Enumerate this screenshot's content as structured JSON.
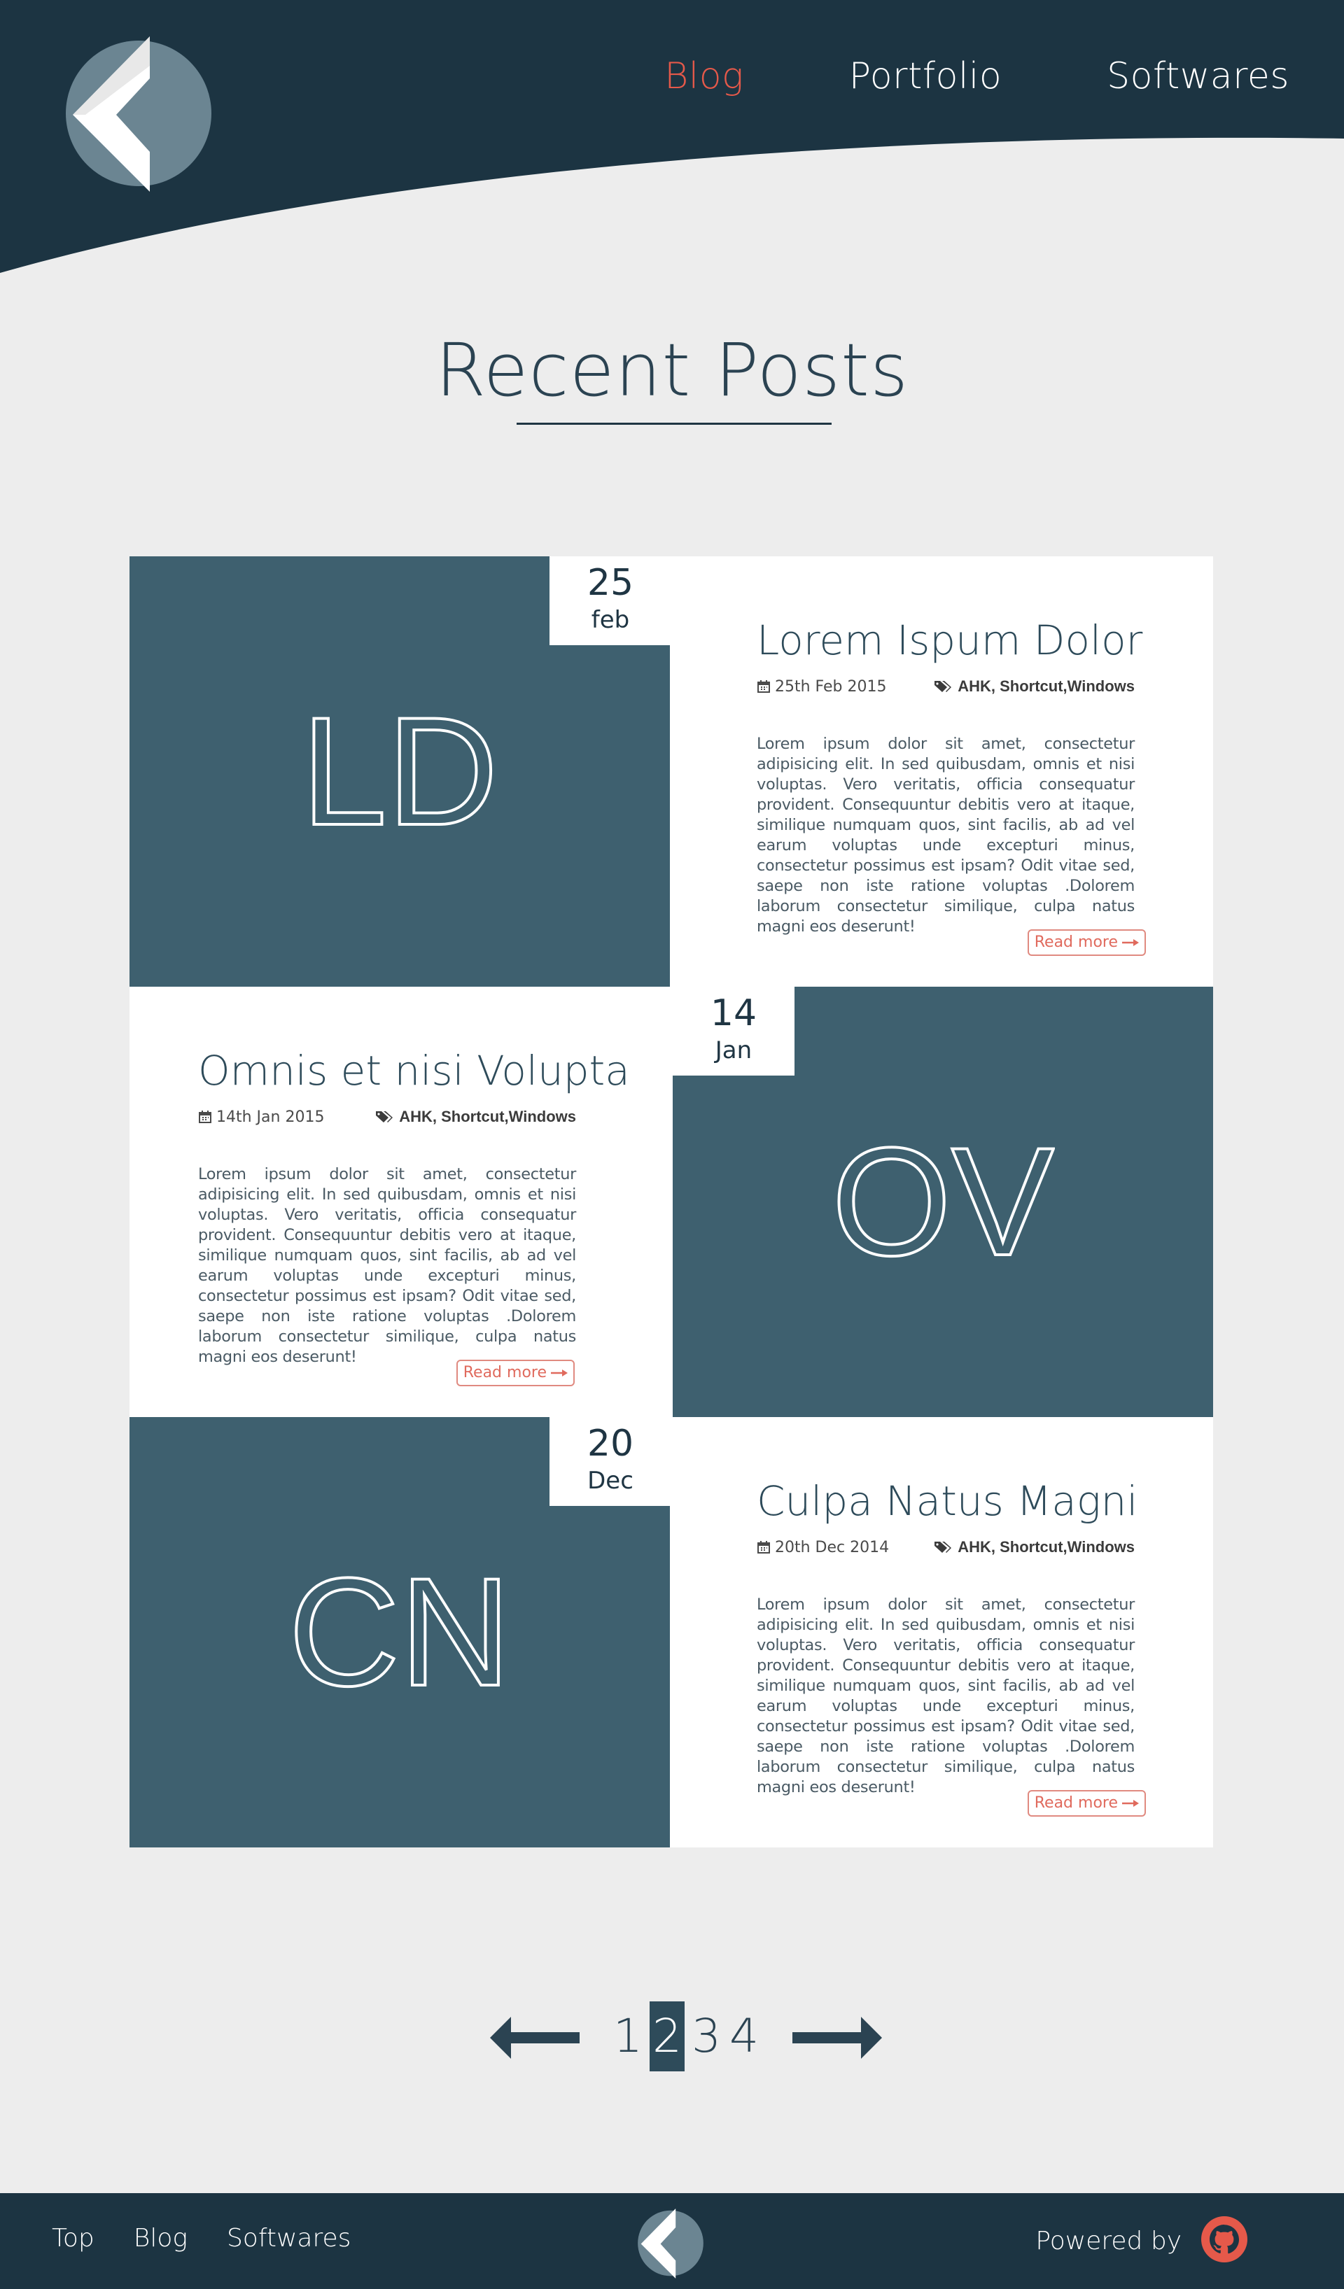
{
  "header": {
    "logo_alt": "logo",
    "nav": [
      {
        "label": "Blog",
        "active": true
      },
      {
        "label": "Portfolio",
        "active": false
      },
      {
        "label": "Softwares",
        "active": false
      }
    ]
  },
  "main": {
    "title": "Recent Posts",
    "posts": [
      {
        "initials": "LD",
        "day": "25",
        "month": "feb",
        "title": "Lorem Ispum Dolor",
        "date": "25th Feb 2015",
        "tags": "AHK, Shortcut,Windows",
        "excerpt": "Lorem ipsum dolor sit amet, consectetur adipisicing elit. In sed quibusdam, omnis et nisi voluptas. Vero veritatis, officia consequatur provident. Consequuntur debitis vero at itaque, similique numquam quos, sint facilis, ab ad vel earum voluptas unde excepturi minus, consectetur possimus est ipsam? Odit vitae sed, saepe non iste ratione voluptas .Dolorem laborum consectetur similique, culpa natus magni eos deserunt!",
        "read_more": "Read more"
      },
      {
        "initials": "OV",
        "day": "14",
        "month": "Jan",
        "title": "Omnis et nisi Volupta",
        "date": "14th Jan 2015",
        "tags": "AHK, Shortcut,Windows",
        "excerpt": "Lorem ipsum dolor sit amet, consectetur adipisicing elit. In sed quibusdam, omnis et nisi voluptas. Vero veritatis, officia consequatur provident. Consequuntur debitis vero at itaque, similique numquam quos, sint facilis, ab ad vel earum voluptas unde excepturi minus, consectetur possimus est ipsam? Odit vitae sed, saepe non iste ratione voluptas .Dolorem laborum consectetur similique, culpa natus magni eos deserunt!",
        "read_more": "Read more"
      },
      {
        "initials": "CN",
        "day": "20",
        "month": "Dec",
        "title": "Culpa Natus Magni",
        "date": "20th Dec 2014",
        "tags": "AHK, Shortcut,Windows",
        "excerpt": "Lorem ipsum dolor sit amet, consectetur adipisicing elit. In sed quibusdam, omnis et nisi voluptas. Vero veritatis, officia consequatur provident. Consequuntur debitis vero at itaque, similique numquam quos, sint facilis, ab ad vel earum voluptas unde excepturi minus, consectetur possimus est ipsam? Odit vitae sed, saepe non iste ratione voluptas .Dolorem laborum consectetur similique, culpa natus magni eos deserunt!",
        "read_more": "Read more"
      }
    ]
  },
  "pagination": {
    "pages": [
      "1",
      "2",
      "3",
      "4"
    ],
    "current": "2",
    "prev_icon": "arrow-left-icon",
    "next_icon": "arrow-right-icon"
  },
  "footer": {
    "links": [
      "Top",
      "Blog",
      "Softwares"
    ],
    "powered_by": "Powered by",
    "github_icon": "github-icon"
  },
  "colors": {
    "header_bg": "#1c3442",
    "accent": "#e5594a",
    "thumb_bg": "#3e606f",
    "page_bg": "#ededed"
  }
}
